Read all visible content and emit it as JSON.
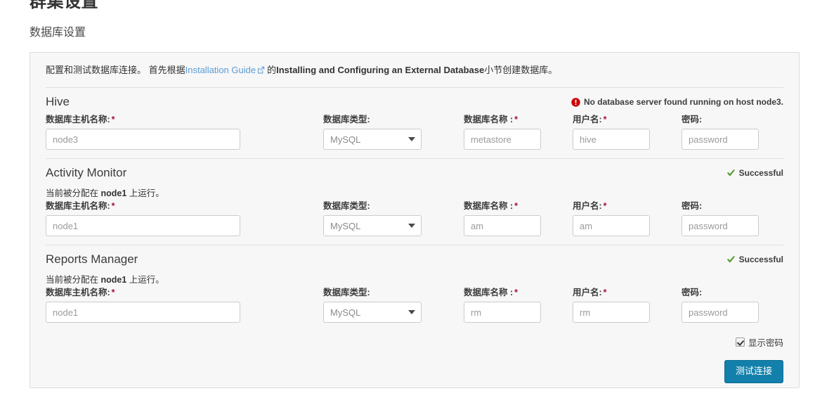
{
  "page": {
    "title": "群集设置",
    "subtitle": "数据库设置"
  },
  "panel": {
    "description": {
      "prefix": "配置和测试数据库连接。 首先根据",
      "link_text": "Installation Guide",
      "link_icon": "external-link-icon",
      "middle": "的",
      "bold_text": "Installing and Configuring an External Database",
      "suffix": "小节创建数据库。"
    },
    "sections": [
      {
        "title": "Hive",
        "status": {
          "type": "error",
          "icon": "error-circle-icon",
          "text": "No database server found running on host node3."
        },
        "assigned_note": null,
        "fields": {
          "host": {
            "label": "数据库主机名称:",
            "required": true,
            "value": "node3",
            "placeholder": "node3"
          },
          "type": {
            "label": "数据库类型:",
            "required": false,
            "value": "MySQL"
          },
          "dbname": {
            "label": "数据库名称 :",
            "required": true,
            "value": "metastore",
            "placeholder": "metastore"
          },
          "user": {
            "label": "用户名:",
            "required": true,
            "value": "hive",
            "placeholder": "hive"
          },
          "password": {
            "label": "密码:",
            "required": false,
            "value": "password",
            "placeholder": "password"
          }
        }
      },
      {
        "title": "Activity Monitor",
        "status": {
          "type": "ok",
          "icon": "check-icon",
          "text": "Successful"
        },
        "assigned_note": {
          "prefix": "当前被分配在 ",
          "host": "node1",
          "suffix": " 上运行。"
        },
        "fields": {
          "host": {
            "label": "数据库主机名称:",
            "required": true,
            "value": "node1",
            "placeholder": "node1"
          },
          "type": {
            "label": "数据库类型:",
            "required": false,
            "value": "MySQL"
          },
          "dbname": {
            "label": "数据库名称 :",
            "required": true,
            "value": "am",
            "placeholder": "am"
          },
          "user": {
            "label": "用户名:",
            "required": true,
            "value": "am",
            "placeholder": "am"
          },
          "password": {
            "label": "密码:",
            "required": false,
            "value": "password",
            "placeholder": "password"
          }
        }
      },
      {
        "title": "Reports Manager",
        "status": {
          "type": "ok",
          "icon": "check-icon",
          "text": "Successful"
        },
        "assigned_note": {
          "prefix": "当前被分配在 ",
          "host": "node1",
          "suffix": " 上运行。"
        },
        "fields": {
          "host": {
            "label": "数据库主机名称:",
            "required": true,
            "value": "node1",
            "placeholder": "node1"
          },
          "type": {
            "label": "数据库类型:",
            "required": false,
            "value": "MySQL"
          },
          "dbname": {
            "label": "数据库名称 :",
            "required": true,
            "value": "rm",
            "placeholder": "rm"
          },
          "user": {
            "label": "用户名:",
            "required": true,
            "value": "rm",
            "placeholder": "rm"
          },
          "password": {
            "label": "密码:",
            "required": false,
            "value": "password",
            "placeholder": "password"
          }
        }
      }
    ],
    "footer": {
      "show_password_label": "显示密码",
      "show_password_checked": true,
      "test_button_label": "测试连接"
    }
  },
  "colors": {
    "link": "#5b9bd5",
    "required": "#a5123c",
    "error": "#cc0000",
    "success": "#4f9a29",
    "button": "#1280ab",
    "panel_bg": "#f7f7f7",
    "panel_border": "#dcdcdc"
  }
}
